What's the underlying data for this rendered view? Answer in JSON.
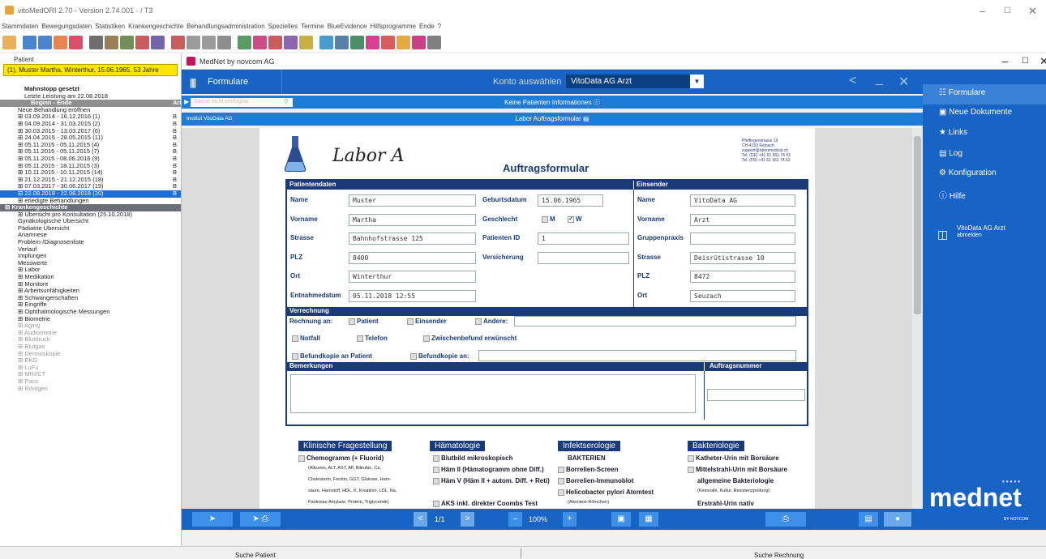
{
  "window": {
    "title": "vitoMedORI 2.70  -  Version 2.74.001 · / T3"
  },
  "menu": [
    "Stammdaten",
    "Bewegungsdaten",
    "Statistiken",
    "Krankengeschichte",
    "Behandlungsadministration",
    "Spezielles",
    "Termine",
    "BlueEvidence",
    "Hilfsprogramme",
    "Ende",
    "?"
  ],
  "left": {
    "header": "Patient",
    "patient": "(1), Muster Martha, Winterthur, 15.06.1965, 53 Jahre",
    "tree": [
      {
        "t": "Mahnstopp gesetzt",
        "c": "bold"
      },
      {
        "t": "Letzte Leistung am 22.08.2018",
        "c": ""
      },
      {
        "t": "Beginn  -  Ende",
        "c": "hdrrow",
        "b": "Art"
      },
      {
        "t": "Neue Behandlung eröffnen",
        "c": ""
      },
      {
        "t": "⊞ 03.09.2014 - 16.12.2016 (1)",
        "c": "",
        "b": "B"
      },
      {
        "t": "⊞ 04.09.2014 - 31.03.2015 (2)",
        "c": "",
        "b": "B"
      },
      {
        "t": "⊞ 30.03.2015 - 13.03.2017 (6)",
        "c": "",
        "b": "B"
      },
      {
        "t": "⊞ 24.04.2015 - 28.05.2015 (11)",
        "c": "",
        "b": "B"
      },
      {
        "t": "⊞ 05.11.2015 - 05.11.2015 (4)",
        "c": "",
        "b": "B"
      },
      {
        "t": "⊞ 05.11.2015 - 05.11.2015 (7)",
        "c": "",
        "b": "B"
      },
      {
        "t": "⊞ 05.11.2015 - 08.06.2016 (9)",
        "c": "",
        "b": "B"
      },
      {
        "t": "⊞ 05.11.2015 - 18.11.2015 (3)",
        "c": "",
        "b": "B"
      },
      {
        "t": "⊞ 10.11.2015 - 10.11.2015 (14)",
        "c": "",
        "b": "B"
      },
      {
        "t": "⊞ 21.12.2015 - 21.12.2015 (18)",
        "c": "",
        "b": "B"
      },
      {
        "t": "⊞ 07.03.2017 - 30.06.2017 (19)",
        "c": "",
        "b": "B"
      },
      {
        "t": "⊟ 22.08.2018 - 22.08.2018 (20)",
        "c": "sel",
        "b": "B"
      },
      {
        "t": "⊞ erledigte Behandlungen",
        "c": ""
      },
      {
        "t": "⊟ Krankengeschichte",
        "c": "sec"
      },
      {
        "t": "⊞ Übersicht pro Konsultation (25.10.2018)",
        "c": ""
      },
      {
        "t": "   Gynäkologische Übersicht",
        "c": ""
      },
      {
        "t": "   Pädiatrie Übersicht",
        "c": ""
      },
      {
        "t": "   Anamnese",
        "c": ""
      },
      {
        "t": "   Problem-/Diagnosenliste",
        "c": ""
      },
      {
        "t": "   Verlauf",
        "c": ""
      },
      {
        "t": "   Impfungen",
        "c": ""
      },
      {
        "t": "   Messwerte",
        "c": ""
      },
      {
        "t": "⊞ Labor",
        "c": ""
      },
      {
        "t": "⊞ Medikation",
        "c": ""
      },
      {
        "t": "⊞ Monitore",
        "c": ""
      },
      {
        "t": "⊞ Arbeitsunfähigkeiten",
        "c": ""
      },
      {
        "t": "⊞ Schwangerschaften",
        "c": ""
      },
      {
        "t": "⊞ Eingriffe",
        "c": ""
      },
      {
        "t": "⊞ Ophthalmologische Messungen",
        "c": ""
      },
      {
        "t": "⊞ Biometrie",
        "c": ""
      },
      {
        "t": "⊞ Aging",
        "c": "grey"
      },
      {
        "t": "⊞ Audiometrie",
        "c": "grey"
      },
      {
        "t": "⊞ Blutdruck",
        "c": "grey"
      },
      {
        "t": "⊞ Blutgas",
        "c": "grey"
      },
      {
        "t": "⊞ Dermoskopie",
        "c": "grey"
      },
      {
        "t": "⊞ EKG",
        "c": "grey"
      },
      {
        "t": "⊞ LuFu",
        "c": "grey"
      },
      {
        "t": "⊞ MRI/CT",
        "c": "grey"
      },
      {
        "t": "⊞ Pacs",
        "c": "grey"
      },
      {
        "t": "⊞ Röntgen",
        "c": "grey"
      }
    ]
  },
  "mednet": {
    "window_title": "MedNet by novcom AG",
    "formulare": "Formulare",
    "konto_label": "Konto auswählen",
    "konto_value": "VitoData AG Arzt",
    "search_placeholder": "Suche nicht verfügbar",
    "no_patient_info": "Keine Patienten Informationen ⓘ",
    "institute": "Institut VitoData AG",
    "form_caption": "Labor Auftragsformular ▤",
    "page": "1/1",
    "zoom": "100%"
  },
  "form": {
    "lab_name": "Labor A",
    "title": "Auftragsformular",
    "address": [
      "Pfeffingerstrasse 19",
      "CH-4153 Reinach",
      "support@openmedical.ch",
      "Tel. (DE) +41 61 561 74 61",
      "Tel. (FR) +41 61 561 74 62"
    ],
    "patient_header": "Patientendaten",
    "sender_header": "Einsender",
    "fields": {
      "name_l": "Name",
      "name_v": "Muster",
      "vorname_l": "Vorname",
      "vorname_v": "Martha",
      "strasse_l": "Strasse",
      "strasse_v": "Bahnhofstrasse 125",
      "plz_l": "PLZ",
      "plz_v": "8400",
      "ort_l": "Ort",
      "ort_v": "Winterthur",
      "entnahme_l": "Entnahmedatum",
      "entnahme_v": "05.11.2018 12:55",
      "geb_l": "Geburtsdatum",
      "geb_v": "15.06.1965",
      "geschlecht_l": "Geschlecht",
      "m": "M",
      "w": "W",
      "pid_l": "Patienten ID",
      "pid_v": "1",
      "vers_l": "Versicherung",
      "e_name_l": "Name",
      "e_name_v": "VitoData AG",
      "e_vorname_l": "Vorname",
      "e_vorname_v": "Arzt",
      "e_gruppe_l": "Gruppenpraxis",
      "e_strasse_l": "Strasse",
      "e_strasse_v": "Deisrütistrasse 10",
      "e_plz_l": "PLZ",
      "e_plz_v": "8472",
      "e_ort_l": "Ort",
      "e_ort_v": "Seuzach"
    },
    "verrechnung": "Verrechnung",
    "rechnung_an": "Rechnung an:",
    "patient_cb": "Patient",
    "einsender_cb": "Einsender",
    "andere_cb": "Andere:",
    "notfall": "Notfall",
    "telefon": "Telefon",
    "zwischen": "Zwischenbefund erwünscht",
    "befundkopie_pat": "Befundkopie an Patient",
    "befundkopie_an": "Befundkopie an:",
    "bemerkungen": "Bemerkungen",
    "auftragsnummer": "Auftragsnummer",
    "sections": {
      "klinisch": "Klinische Fragestellung",
      "haematologie": "Hämatologie",
      "infekt": "Infektserologie",
      "bakterio": "Bakteriologie"
    },
    "klinisch_items": [
      "Chemogramm (+ Fluorid)",
      "(Albumin, ALT, AST, AP, Bilirubin, Ca,",
      "Cholesterin, Ferritin, GGT, Glukose, Harn-",
      "säure, Harnstoff, HDL, K, Kreatinin, LDL, Na,",
      "Pankreas-Amylase, Protein, Triglyceride)"
    ],
    "haema_items": [
      "Blutbild mikroskopisch",
      "Häm II (Hämatogramm ohne Diff.)",
      "Häm V (Häm II + autom. Diff. + Reti)",
      "AKS inkl. direkter Coombs Test"
    ],
    "infekt_items": [
      "BAKTERIEN",
      "Borrelien-Screen",
      "Borrelien-Immunoblot",
      "Helicobacter pylori Atemtest",
      "(Atemtest-Röhrchen)"
    ],
    "bakt_items": [
      "Katheter-Urin mit Borsäure",
      "Mittelstrahl-Urin mit Borsäure",
      "allgemeine Bakteriologie",
      "(Keimzahl, Kultur, Resistenzprüfung)",
      "Erstrahl-Urin nativ"
    ]
  },
  "right": {
    "items": [
      "Formulare",
      "Neue Dokumente",
      "Links",
      "Log",
      "Konfiguration",
      "Hilfe"
    ],
    "account": "VitoData AG Arzt",
    "logout": "abmelden",
    "brand": "mednet",
    "brand_sub": "BY NOVCOM"
  },
  "status": {
    "left": "Suche Patient",
    "right": "Suche Rechnung"
  },
  "colors": {
    "accent": "#1864c4",
    "form_navy": "#1a3a7a",
    "selection": "#1e6fd0",
    "patient_box": "#ffe600"
  }
}
